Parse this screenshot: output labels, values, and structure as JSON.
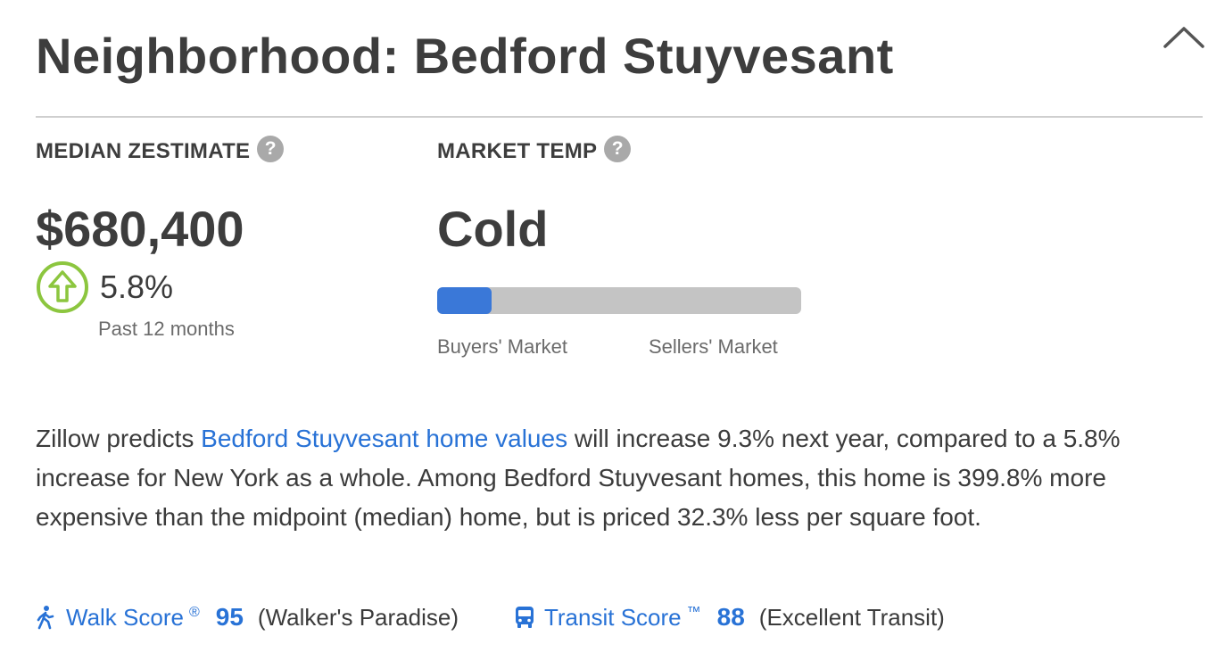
{
  "header": {
    "title": "Neighborhood: Bedford Stuyvesant"
  },
  "median_zestimate": {
    "label": "MEDIAN ZESTIMATE",
    "help": "?",
    "value": "$680,400",
    "change": "5.8%",
    "change_direction": "up",
    "period": "Past 12 months"
  },
  "market_temp": {
    "label": "MARKET TEMP",
    "help": "?",
    "value": "Cold",
    "level_fraction": 0.15,
    "scale_left": "Buyers' Market",
    "scale_right": "Sellers' Market"
  },
  "description": {
    "prefix": "Zillow predicts ",
    "link": "Bedford Stuyvesant home values",
    "suffix": " will increase 9.3% next year, compared to a 5.8% increase for New York as a whole. Among Bedford Stuyvesant homes, this home is 399.8% more expensive than the midpoint (median) home, but is priced 32.3% less per square foot."
  },
  "scores": {
    "walk": {
      "name": "Walk Score",
      "mark": "®",
      "value": "95",
      "desc": "(Walker's Paradise)"
    },
    "transit": {
      "name": "Transit Score",
      "mark": "™",
      "value": "88",
      "desc": "(Excellent Transit)"
    }
  },
  "colors": {
    "accent_blue": "#2872d6",
    "bar_fill": "#3a78d8",
    "bar_track": "#c4c4c4",
    "up_green": "#8cc63f"
  }
}
